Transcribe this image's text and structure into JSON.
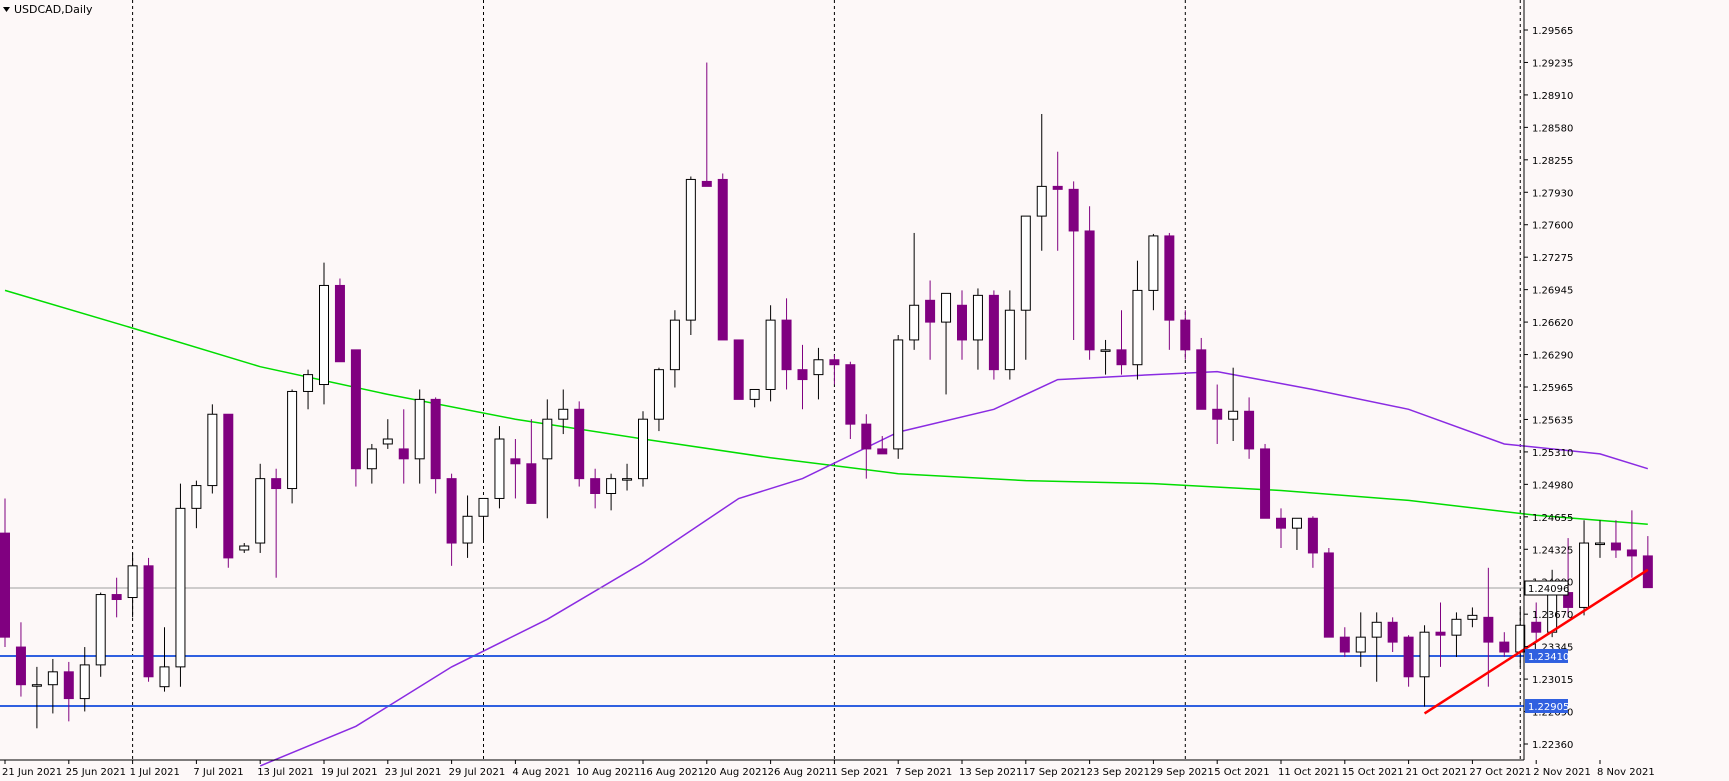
{
  "window": {
    "title": "USDCAD,Daily",
    "menu_icon": "triangle-down-icon"
  },
  "colors": {
    "background": "#fdf8f8",
    "bull_fill": "#ffffff",
    "bull_stroke": "#000000",
    "bear_fill": "#800080",
    "bear_stroke": "#800080",
    "ma_fast": "#8a2be2",
    "ma_slow": "#00dd00",
    "support": "#3060e0",
    "trendline": "#ff0000",
    "price_line": "#a0a0a0",
    "grid_dashed": "#000000",
    "axis_label_bg": "#3060e0"
  },
  "chart_data": {
    "type": "candlestick",
    "symbol": "USDCAD",
    "timeframe": "Daily",
    "ylim": [
      1.2236,
      1.2989
    ],
    "y_ticks": [
      "1.29565",
      "1.29235",
      "1.28910",
      "1.28580",
      "1.28255",
      "1.27930",
      "1.27600",
      "1.27275",
      "1.26945",
      "1.26620",
      "1.26290",
      "1.25965",
      "1.25635",
      "1.25310",
      "1.24980",
      "1.24655",
      "1.24325",
      "1.24000",
      "1.23670",
      "1.23345",
      "1.23015",
      "1.22690",
      "1.22360"
    ],
    "x_labels": [
      "21 Jun 2021",
      "25 Jun 2021",
      "1 Jul 2021",
      "7 Jul 2021",
      "13 Jul 2021",
      "19 Jul 2021",
      "23 Jul 2021",
      "29 Jul 2021",
      "4 Aug 2021",
      "10 Aug 2021",
      "16 Aug 2021",
      "20 Aug 2021",
      "26 Aug 2021",
      "1 Sep 2021",
      "7 Sep 2021",
      "13 Sep 2021",
      "17 Sep 2021",
      "23 Sep 2021",
      "29 Sep 2021",
      "5 Oct 2021",
      "11 Oct 2021",
      "15 Oct 2021",
      "21 Oct 2021",
      "27 Oct 2021",
      "2 Nov 2021",
      "8 Nov 2021"
    ],
    "x_label_index": [
      0,
      4,
      8,
      12,
      16,
      20,
      24,
      28,
      32,
      36,
      40,
      44,
      48,
      52,
      56,
      60,
      64,
      68,
      72,
      76,
      80,
      84,
      88,
      92,
      96,
      100
    ],
    "separator_index": [
      8,
      30,
      52,
      74,
      95
    ],
    "candles": [
      [
        1.2465,
        1.25,
        1.235,
        1.236
      ],
      [
        1.235,
        1.2375,
        1.23,
        1.2312
      ],
      [
        1.2312,
        1.233,
        1.2268,
        1.2312
      ],
      [
        1.2312,
        1.2338,
        1.2283,
        1.2325
      ],
      [
        1.2325,
        1.2335,
        1.2275,
        1.2298
      ],
      [
        1.2298,
        1.235,
        1.2285,
        1.2332
      ],
      [
        1.2332,
        1.2405,
        1.232,
        1.2403
      ],
      [
        1.2403,
        1.242,
        1.238,
        1.2398
      ],
      [
        1.24,
        1.2445,
        1.238,
        1.2432
      ],
      [
        1.2432,
        1.244,
        1.2315,
        1.232
      ],
      [
        1.231,
        1.237,
        1.2305,
        1.233
      ],
      [
        1.233,
        1.2515,
        1.231,
        1.249
      ],
      [
        1.249,
        1.2518,
        1.247,
        1.2513
      ],
      [
        1.2513,
        1.2595,
        1.2505,
        1.2585
      ],
      [
        1.2585,
        1.256,
        1.243,
        1.244
      ],
      [
        1.2448,
        1.2455,
        1.2445,
        1.2452
      ],
      [
        1.2455,
        1.2535,
        1.2445,
        1.252
      ],
      [
        1.252,
        1.253,
        1.242,
        1.251
      ],
      [
        1.251,
        1.261,
        1.2495,
        1.2608
      ],
      [
        1.2608,
        1.263,
        1.259,
        1.2625
      ],
      [
        1.2615,
        1.2738,
        1.2595,
        1.2715
      ],
      [
        1.2715,
        1.2722,
        1.264,
        1.2638
      ],
      [
        1.265,
        1.2638,
        1.2512,
        1.253
      ],
      [
        1.253,
        1.2555,
        1.2515,
        1.255
      ],
      [
        1.2555,
        1.258,
        1.255,
        1.256
      ],
      [
        1.255,
        1.259,
        1.2515,
        1.254
      ],
      [
        1.254,
        1.261,
        1.2515,
        1.26
      ],
      [
        1.26,
        1.2602,
        1.2505,
        1.252
      ],
      [
        1.252,
        1.2525,
        1.2432,
        1.2455
      ],
      [
        1.2455,
        1.2503,
        1.244,
        1.2482
      ],
      [
        1.2482,
        1.249,
        1.2458,
        1.25
      ],
      [
        1.25,
        1.2573,
        1.249,
        1.256
      ],
      [
        1.254,
        1.256,
        1.25,
        1.2535
      ],
      [
        1.2535,
        1.258,
        1.2505,
        1.2495
      ],
      [
        1.254,
        1.26,
        1.248,
        1.258
      ],
      [
        1.258,
        1.261,
        1.2565,
        1.259
      ],
      [
        1.259,
        1.2598,
        1.2512,
        1.252
      ],
      [
        1.252,
        1.253,
        1.249,
        1.2505
      ],
      [
        1.2505,
        1.2525,
        1.2488,
        1.252
      ],
      [
        1.252,
        1.2535,
        1.2508,
        1.252
      ],
      [
        1.252,
        1.2588,
        1.2512,
        1.258
      ],
      [
        1.258,
        1.2632,
        1.2568,
        1.263
      ],
      [
        1.263,
        1.269,
        1.2612,
        1.268
      ],
      [
        1.268,
        1.2825,
        1.2665,
        1.2822
      ],
      [
        1.282,
        1.294,
        1.2815,
        1.2815
      ],
      [
        1.2822,
        1.2828,
        1.2665,
        1.266
      ],
      [
        1.266,
        1.266,
        1.2605,
        1.26
      ],
      [
        1.26,
        1.2608,
        1.2592,
        1.261
      ],
      [
        1.261,
        1.2695,
        1.2598,
        1.268
      ],
      [
        1.268,
        1.2702,
        1.261,
        1.263
      ],
      [
        1.263,
        1.2655,
        1.259,
        1.262
      ],
      [
        1.2625,
        1.2652,
        1.26,
        1.264
      ],
      [
        1.264,
        1.2645,
        1.2615,
        1.2635
      ],
      [
        1.2635,
        1.2638,
        1.256,
        1.2575
      ],
      [
        1.2575,
        1.2585,
        1.252,
        1.255
      ],
      [
        1.255,
        1.2563,
        1.2545,
        1.2545
      ],
      [
        1.255,
        1.2665,
        1.254,
        1.266
      ],
      [
        1.266,
        1.2768,
        1.265,
        1.2695
      ],
      [
        1.27,
        1.272,
        1.264,
        1.2678
      ],
      [
        1.2678,
        1.2705,
        1.2605,
        1.2707
      ],
      [
        1.2695,
        1.271,
        1.264,
        1.266
      ],
      [
        1.266,
        1.2712,
        1.263,
        1.2705
      ],
      [
        1.2705,
        1.271,
        1.262,
        1.263
      ],
      [
        1.263,
        1.271,
        1.262,
        1.269
      ],
      [
        1.269,
        1.2775,
        1.264,
        1.2785
      ],
      [
        1.2785,
        1.2888,
        1.275,
        1.2815
      ],
      [
        1.2815,
        1.285,
        1.275,
        1.2812
      ],
      [
        1.2812,
        1.282,
        1.266,
        1.277
      ],
      [
        1.277,
        1.2795,
        1.264,
        1.265
      ],
      [
        1.265,
        1.266,
        1.2625,
        1.265
      ],
      [
        1.265,
        1.269,
        1.2625,
        1.2635
      ],
      [
        1.2635,
        1.274,
        1.262,
        1.271
      ],
      [
        1.271,
        1.2767,
        1.269,
        1.2765
      ],
      [
        1.2765,
        1.2768,
        1.265,
        1.268
      ],
      [
        1.268,
        1.269,
        1.264,
        1.265
      ],
      [
        1.265,
        1.2662,
        1.259,
        1.259
      ],
      [
        1.259,
        1.2615,
        1.2555,
        1.258
      ],
      [
        1.258,
        1.2632,
        1.2558,
        1.2588
      ],
      [
        1.2588,
        1.2602,
        1.254,
        1.255
      ],
      [
        1.255,
        1.2555,
        1.248,
        1.248
      ],
      [
        1.248,
        1.249,
        1.245,
        1.247
      ],
      [
        1.247,
        1.248,
        1.2448,
        1.248
      ],
      [
        1.248,
        1.2482,
        1.243,
        1.2445
      ],
      [
        1.2445,
        1.245,
        1.236,
        1.236
      ],
      [
        1.236,
        1.237,
        1.234,
        1.2345
      ],
      [
        1.2345,
        1.2385,
        1.233,
        1.236
      ],
      [
        1.236,
        1.2385,
        1.2315,
        1.2375
      ],
      [
        1.2375,
        1.238,
        1.2345,
        1.2355
      ],
      [
        1.236,
        1.2362,
        1.231,
        1.232
      ],
      [
        1.232,
        1.2372,
        1.229,
        1.2365
      ],
      [
        1.2365,
        1.2395,
        1.233,
        1.2362
      ],
      [
        1.2362,
        1.2385,
        1.234,
        1.2378
      ],
      [
        1.2378,
        1.239,
        1.237,
        1.2382
      ],
      [
        1.238,
        1.243,
        1.231,
        1.2355
      ],
      [
        1.2355,
        1.2365,
        1.234,
        1.2345
      ],
      [
        1.2345,
        1.239,
        1.233,
        1.2372
      ],
      [
        1.2375,
        1.2395,
        1.2355,
        1.2365
      ],
      [
        1.2365,
        1.2428,
        1.236,
        1.2405
      ],
      [
        1.2405,
        1.246,
        1.238,
        1.239
      ],
      [
        1.239,
        1.2478,
        1.2382,
        1.2455
      ],
      [
        1.2455,
        1.2478,
        1.244,
        1.2455
      ],
      [
        1.2455,
        1.2478,
        1.244,
        1.2448
      ],
      [
        1.2448,
        1.2488,
        1.242,
        1.2442
      ],
      [
        1.2442,
        1.2462,
        1.2428,
        1.241
      ]
    ],
    "ma_slow": [
      [
        0,
        1.271
      ],
      [
        8,
        1.2672
      ],
      [
        16,
        1.2633
      ],
      [
        24,
        1.2605
      ],
      [
        32,
        1.258
      ],
      [
        40,
        1.256
      ],
      [
        48,
        1.2541
      ],
      [
        56,
        1.2525
      ],
      [
        64,
        1.2518
      ],
      [
        72,
        1.2515
      ],
      [
        80,
        1.2508
      ],
      [
        88,
        1.2498
      ],
      [
        96,
        1.2483
      ],
      [
        103,
        1.2474
      ]
    ],
    "ma_fast": [
      [
        16,
        1.223
      ],
      [
        22,
        1.227
      ],
      [
        28,
        1.233
      ],
      [
        34,
        1.2378
      ],
      [
        40,
        1.2435
      ],
      [
        46,
        1.25
      ],
      [
        50,
        1.252
      ],
      [
        56,
        1.2567
      ],
      [
        62,
        1.259
      ],
      [
        66,
        1.262
      ],
      [
        72,
        1.2625
      ],
      [
        76,
        1.2628
      ],
      [
        82,
        1.261
      ],
      [
        88,
        1.259
      ],
      [
        94,
        1.2555
      ],
      [
        100,
        1.2545
      ],
      [
        103,
        1.253
      ]
    ],
    "support_levels": [
      {
        "value": 1.2341,
        "label": "1.23410"
      },
      {
        "value": 1.22905,
        "label": "1.22905"
      }
    ],
    "trendline": {
      "x1": 89,
      "y1": 1.2283,
      "x2": 103,
      "y2": 1.2428
    },
    "current_price": {
      "value": 1.24096,
      "label": "1.24096"
    }
  }
}
